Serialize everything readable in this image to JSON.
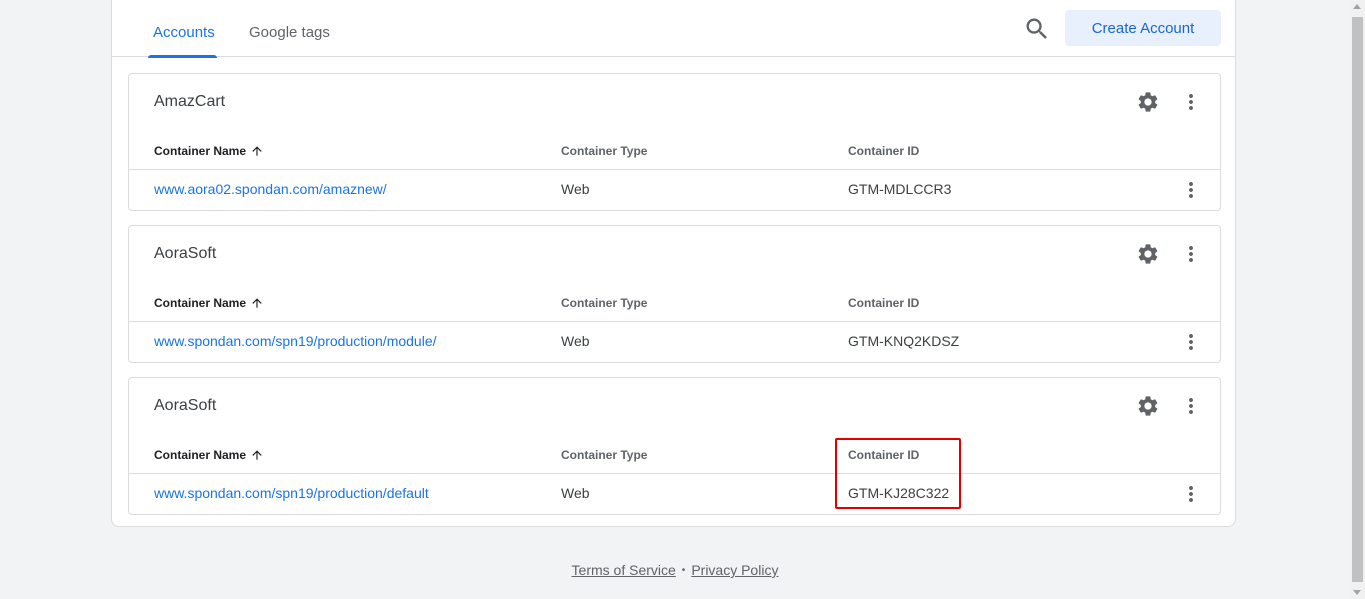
{
  "tabs": {
    "accounts": "Accounts",
    "google_tags": "Google tags"
  },
  "toolbar": {
    "search_icon": "search-icon",
    "create_label": "Create Account"
  },
  "table_headers": {
    "name": "Container Name",
    "type": "Container Type",
    "id": "Container ID"
  },
  "accounts": [
    {
      "name": "AmazCart",
      "container": {
        "name": "www.aora02.spondan.com/amaznew/",
        "type": "Web",
        "id": "GTM-MDLCCR3"
      }
    },
    {
      "name": "AoraSoft",
      "container": {
        "name": "www.spondan.com/spn19/production/module/",
        "type": "Web",
        "id": "GTM-KNQ2KDSZ"
      }
    },
    {
      "name": "AoraSoft",
      "container": {
        "name": "www.spondan.com/spn19/production/default",
        "type": "Web",
        "id": "GTM-KJ28C322"
      }
    }
  ],
  "footer": {
    "terms": "Terms of Service",
    "separator": "•",
    "privacy": "Privacy Policy"
  },
  "colors": {
    "accent": "#1a73e8",
    "highlight": "#e00000"
  }
}
